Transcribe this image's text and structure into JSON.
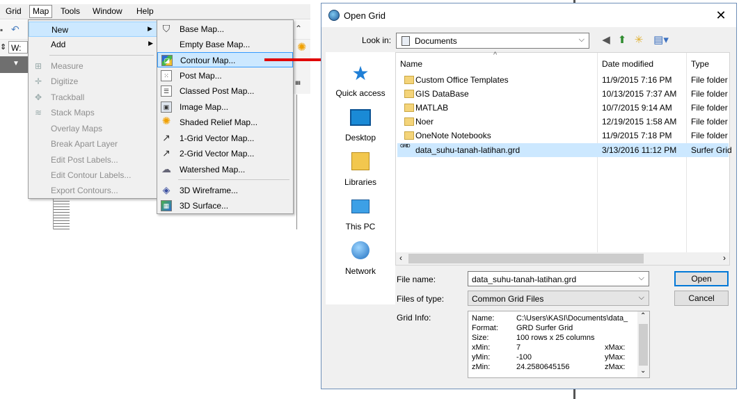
{
  "app": {
    "menubar": [
      "Grid",
      "Map",
      "Tools",
      "Window",
      "Help"
    ],
    "toolbar_field_label": "W:",
    "map_menu": [
      {
        "label": "New",
        "icon": "",
        "disabled": false,
        "submenu": true,
        "highlighted": true
      },
      {
        "label": "Add",
        "icon": "",
        "disabled": false,
        "submenu": true
      },
      {
        "label": "Measure",
        "icon": "ruler-icon",
        "disabled": true
      },
      {
        "label": "Digitize",
        "icon": "crosshair-icon",
        "disabled": true
      },
      {
        "label": "Trackball",
        "icon": "trackball-icon",
        "disabled": true
      },
      {
        "label": "Stack Maps",
        "icon": "stack-maps-icon",
        "disabled": true
      },
      {
        "label": "Overlay Maps",
        "icon": "",
        "disabled": true
      },
      {
        "label": "Break Apart Layer",
        "icon": "",
        "disabled": true
      },
      {
        "label": "Edit Post Labels...",
        "icon": "",
        "disabled": true
      },
      {
        "label": "Edit Contour Labels...",
        "icon": "",
        "disabled": true
      },
      {
        "label": "Export Contours...",
        "icon": "",
        "disabled": true
      }
    ],
    "new_submenu": [
      {
        "label": "Base Map...",
        "icon": "base-map-icon",
        "glyph": "⛉"
      },
      {
        "label": "Empty Base Map...",
        "icon": "",
        "glyph": ""
      },
      {
        "label": "Contour Map...",
        "icon": "contour-map-icon",
        "glyph": "◪",
        "highlighted": true
      },
      {
        "label": "Post Map...",
        "icon": "post-map-icon",
        "glyph": "⁙"
      },
      {
        "label": "Classed Post Map...",
        "icon": "classed-post-map-icon",
        "glyph": "☰"
      },
      {
        "label": "Image Map...",
        "icon": "image-map-icon",
        "glyph": "▣"
      },
      {
        "label": "Shaded Relief Map...",
        "icon": "shaded-relief-map-icon",
        "glyph": "✺"
      },
      {
        "label": "1-Grid Vector Map...",
        "icon": "vector-map-icon",
        "glyph": "↗"
      },
      {
        "label": "2-Grid Vector Map...",
        "icon": "vector-map-2-icon",
        "glyph": "↗"
      },
      {
        "label": "Watershed Map...",
        "icon": "watershed-map-icon",
        "glyph": "☁"
      },
      {
        "label": "3D Wireframe...",
        "icon": "wireframe-icon",
        "glyph": "◈"
      },
      {
        "label": "3D Surface...",
        "icon": "surface-icon",
        "glyph": "▦"
      }
    ]
  },
  "dialog": {
    "title": "Open Grid",
    "look_in_label": "Look in:",
    "look_in_value": "Documents",
    "places": [
      "Quick access",
      "Desktop",
      "Libraries",
      "This PC",
      "Network"
    ],
    "columns": [
      "Name",
      "Date modified",
      "Type"
    ],
    "files": [
      {
        "name": "Custom Office Templates",
        "date": "11/9/2015 7:16 PM",
        "type": "File folder",
        "kind": "folder"
      },
      {
        "name": "GIS DataBase",
        "date": "10/13/2015 7:37 AM",
        "type": "File folder",
        "kind": "folder"
      },
      {
        "name": "MATLAB",
        "date": "10/7/2015 9:14 AM",
        "type": "File folder",
        "kind": "folder"
      },
      {
        "name": "Noer",
        "date": "12/19/2015 1:58 AM",
        "type": "File folder",
        "kind": "folder"
      },
      {
        "name": "OneNote Notebooks",
        "date": "11/9/2015 7:18 PM",
        "type": "File folder",
        "kind": "folder"
      },
      {
        "name": "data_suhu-tanah-latihan.grd",
        "date": "3/13/2016 11:12 PM",
        "type": "Surfer Grid",
        "kind": "grid",
        "selected": true
      }
    ],
    "file_name_label": "File name:",
    "file_name_value": "data_suhu-tanah-latihan.grd",
    "file_type_label": "Files of type:",
    "file_type_value": "Common Grid Files",
    "grid_info_label": "Grid Info:",
    "grid_info": {
      "name_label": "Name:",
      "name_value": "C:\\Users\\KASI\\Documents\\data_",
      "format_label": "Format:",
      "format_value": "GRD Surfer Grid",
      "size_label": "Size:",
      "size_value": "100 rows x 25 columns",
      "xmin_label": "xMin:",
      "xmin_value": "7",
      "xmax_label": "xMax:",
      "ymin_label": "yMin:",
      "ymin_value": "-100",
      "ymax_label": "yMax:",
      "zmin_label": "zMin:",
      "zmin_value": "24.2580645156",
      "zmax_label": "zMax:"
    },
    "open_button": "Open",
    "cancel_button": "Cancel",
    "grid_file_icon_text": "GRID"
  }
}
